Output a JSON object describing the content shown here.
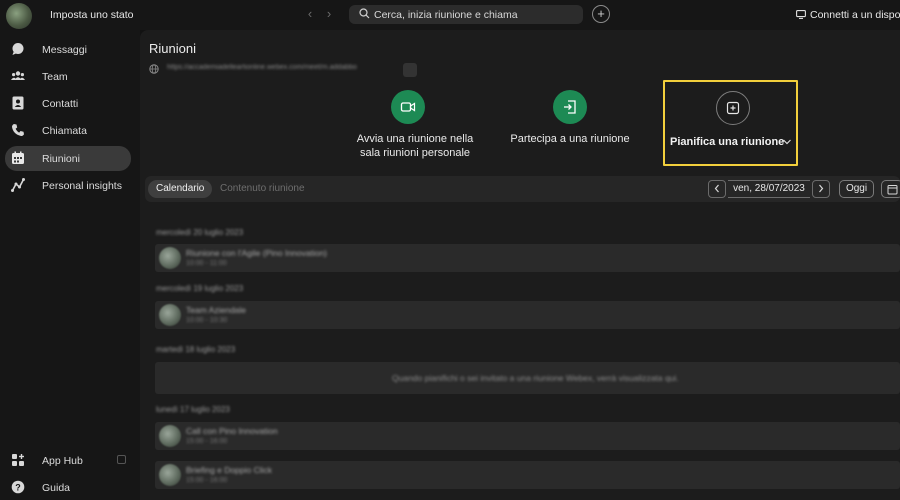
{
  "topbar": {
    "status_label": "Imposta uno stato",
    "search_placeholder": "Cerca, inizia riunione e chiama",
    "connect_label": "Connetti a un disposi"
  },
  "sidebar": {
    "items": [
      {
        "label": "Messaggi",
        "icon": "chat-bubble-icon"
      },
      {
        "label": "Team",
        "icon": "team-icon"
      },
      {
        "label": "Contatti",
        "icon": "contacts-icon"
      },
      {
        "label": "Chiamata",
        "icon": "phone-icon"
      },
      {
        "label": "Riunioni",
        "icon": "calendar-icon",
        "active": true
      },
      {
        "label": "Personal insights",
        "icon": "insights-icon"
      }
    ],
    "bottom": [
      {
        "label": "App Hub",
        "icon": "app-hub-icon"
      },
      {
        "label": "Guida",
        "icon": "help-icon"
      }
    ]
  },
  "main": {
    "title": "Riunioni",
    "personal_url": "https://accademiadelleartionline.webex.com/meet/m.addabbo",
    "actions": {
      "start_line1": "Avvia una riunione nella",
      "start_line2": "sala riunioni personale",
      "join": "Partecipa a una riunione",
      "schedule": "Pianifica una riunione"
    },
    "tabs": [
      {
        "label": "Calendario",
        "active": true
      },
      {
        "label": "Contenuto riunione",
        "active": false
      }
    ],
    "date": "ven, 28/07/2023",
    "today_label": "Oggi"
  },
  "list": {
    "days": [
      "mercoledì 20 luglio 2023",
      "mercoledì 19 luglio 2023",
      "martedì 18 luglio 2023",
      "lunedì 17 luglio 2023"
    ],
    "meetings": [
      {
        "title": "Riunione con l'Agile (Pino Innovation)",
        "time": "10:00 - 11:00"
      },
      {
        "title": "Team Aziendale",
        "time": "10:00 - 10:30"
      },
      {
        "title": "Call con Pino Innovation",
        "time": "15:00 - 16:00"
      },
      {
        "title": "Briefing e Doppio Click",
        "time": "15:00 - 16:00"
      }
    ],
    "empty_message": "Quando pianifichi o sei invitato a una riunione Webex, verrà visualizzata qui."
  }
}
